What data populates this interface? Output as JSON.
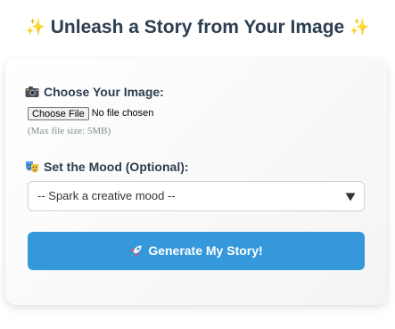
{
  "header": {
    "sparkle_left": "✨",
    "title": "Unleash a Story from Your Image",
    "sparkle_right": "✨"
  },
  "form": {
    "image": {
      "icon": "camera-icon",
      "label": "Choose Your Image:",
      "button_label": "Choose File",
      "status": "No file chosen",
      "hint": "(Max file size: 5MB)"
    },
    "mood": {
      "icon": "theater-masks-icon",
      "label": "Set the Mood (Optional):",
      "selected": "-- Spark a creative mood --"
    },
    "submit": {
      "icon": "rocket-icon",
      "label": "Generate My Story!"
    }
  },
  "colors": {
    "title": "#2c3e50",
    "accent": "#3498db",
    "hint": "#7f8c8d"
  }
}
